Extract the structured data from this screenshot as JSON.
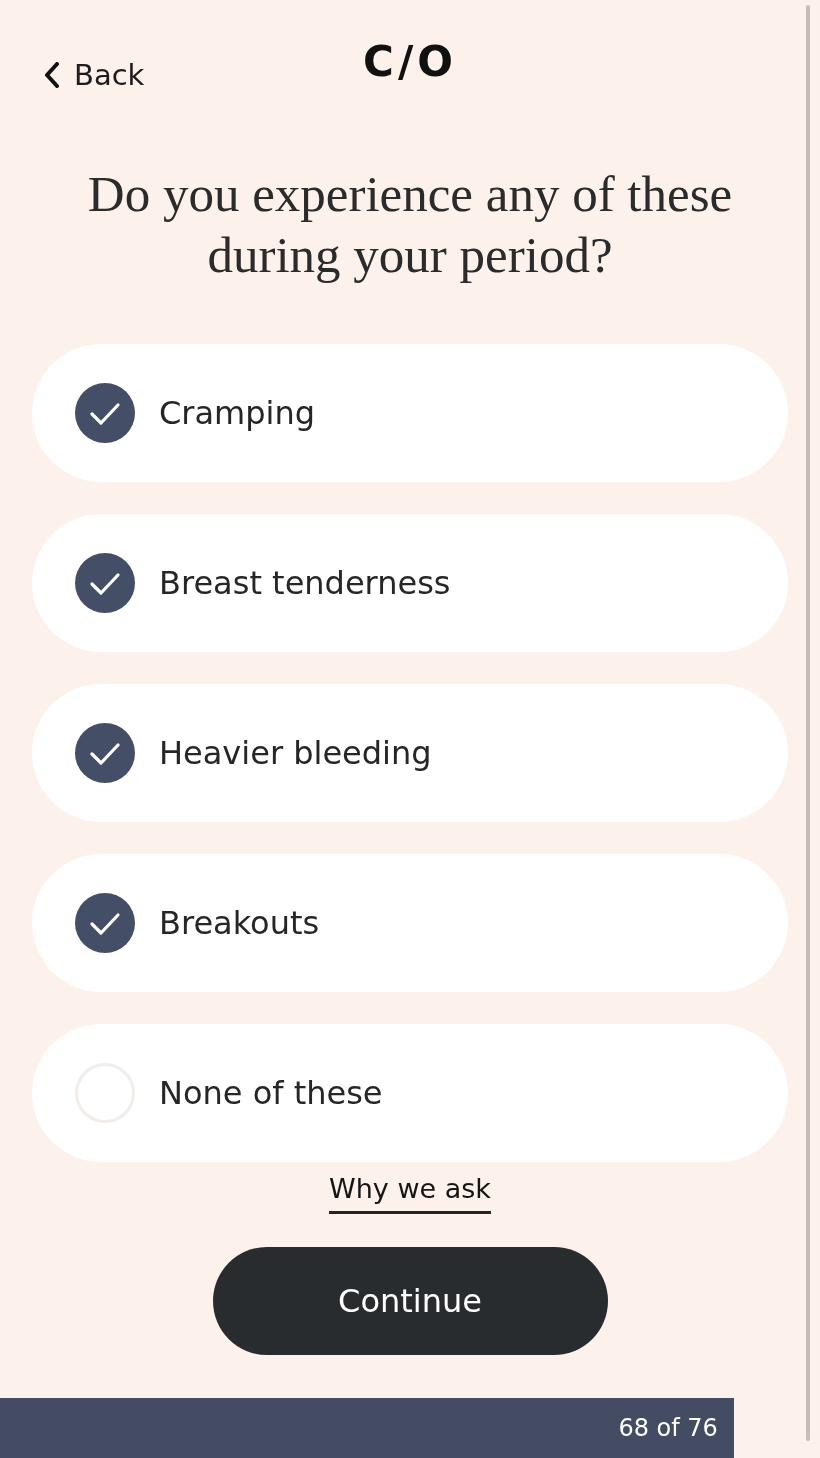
{
  "header": {
    "back_label": "Back",
    "logo": "C/O"
  },
  "question": "Do you experience any of these during your period?",
  "options": [
    {
      "label": "Cramping",
      "checked": true
    },
    {
      "label": "Breast tenderness",
      "checked": true
    },
    {
      "label": "Heavier bleeding",
      "checked": true
    },
    {
      "label": "Breakouts",
      "checked": true
    },
    {
      "label": "None of these",
      "checked": false
    }
  ],
  "why_link": "Why we ask",
  "continue_button": "Continue",
  "progress": {
    "level": 0.895,
    "label": "68 of 76"
  }
}
